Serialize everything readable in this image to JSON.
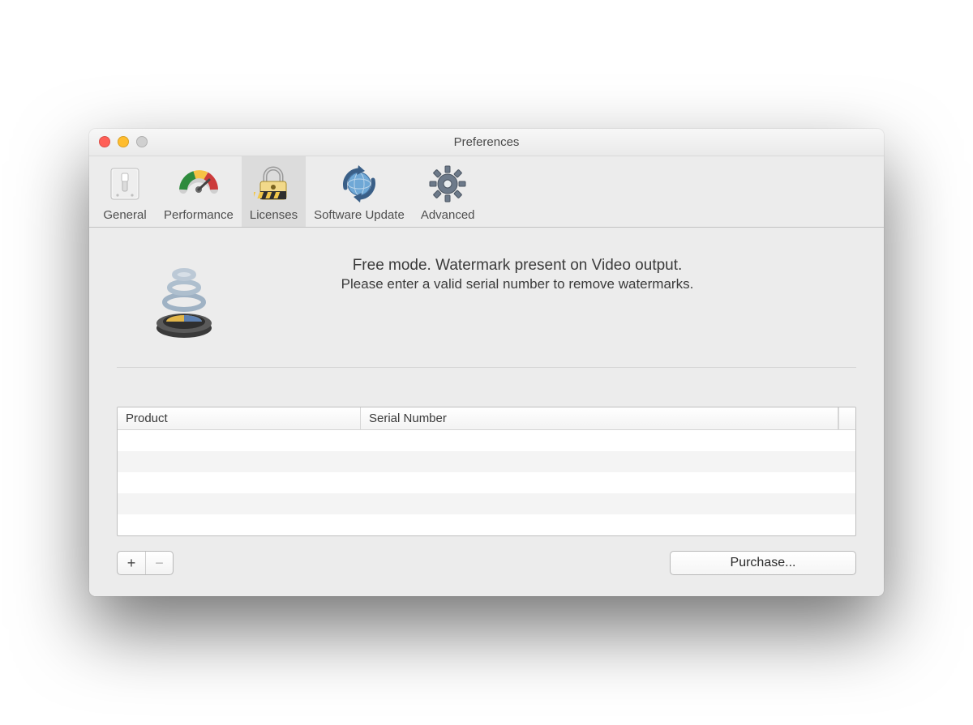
{
  "window": {
    "title": "Preferences"
  },
  "toolbar": {
    "items": [
      {
        "id": "general",
        "label": "General",
        "selected": false
      },
      {
        "id": "perf",
        "label": "Performance",
        "selected": false
      },
      {
        "id": "licenses",
        "label": "Licenses",
        "selected": true
      },
      {
        "id": "swupdate",
        "label": "Software Update",
        "selected": false
      },
      {
        "id": "advanced",
        "label": "Advanced",
        "selected": false
      }
    ]
  },
  "hero": {
    "line1": "Free mode.  Watermark present on Video output.",
    "line2": "Please enter a valid serial number to remove watermarks."
  },
  "table": {
    "columns": {
      "product": "Product",
      "serial": "Serial Number"
    },
    "rows": []
  },
  "footer": {
    "add_label": "+",
    "remove_label": "−",
    "purchase_label": "Purchase..."
  }
}
